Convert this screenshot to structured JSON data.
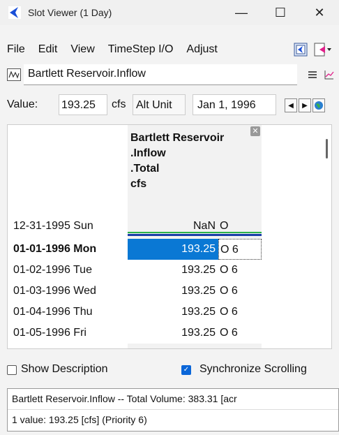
{
  "window": {
    "title": "Slot Viewer (1 Day)",
    "minimize": "—",
    "maximize": "☐",
    "close": "✕"
  },
  "menu": {
    "items": [
      "File",
      "Edit",
      "View",
      "TimeStep I/O",
      "Adjust"
    ]
  },
  "slot": {
    "name": "Bartlett Reservoir.Inflow"
  },
  "value_bar": {
    "label": "Value:",
    "value": "193.25",
    "unit": "cfs",
    "alt_unit_button": "Alt Unit",
    "date": "Jan 1, 1996"
  },
  "table": {
    "column_header_lines": [
      "Bartlett Reservoir",
      ".Inflow",
      ".Total",
      "cfs"
    ],
    "rows": [
      {
        "date": "12-31-1995 Sun",
        "value": "NaN",
        "flag": "O"
      },
      {
        "date": "01-01-1996 Mon",
        "value": "193.25",
        "flag": "O 6"
      },
      {
        "date": "01-02-1996 Tue",
        "value": "193.25",
        "flag": "O 6"
      },
      {
        "date": "01-03-1996 Wed",
        "value": "193.25",
        "flag": "O 6"
      },
      {
        "date": "01-04-1996 Thu",
        "value": "193.25",
        "flag": "O 6"
      },
      {
        "date": "01-05-1996 Fri",
        "value": "193.25",
        "flag": "O 6"
      }
    ],
    "selected_row": 1
  },
  "options": {
    "show_description": "Show Description",
    "show_description_checked": false,
    "sync_scrolling": "Synchronize Scrolling",
    "sync_scrolling_checked": true
  },
  "info": {
    "line1": "Bartlett Reservoir.Inflow -- Total Volume: 383.31 [acr",
    "line2": "1 value:  193.25 [cfs]  (Priority 6)"
  },
  "colors": {
    "accent": "#0a78d4",
    "brand_icon": "#1a4fd8"
  }
}
